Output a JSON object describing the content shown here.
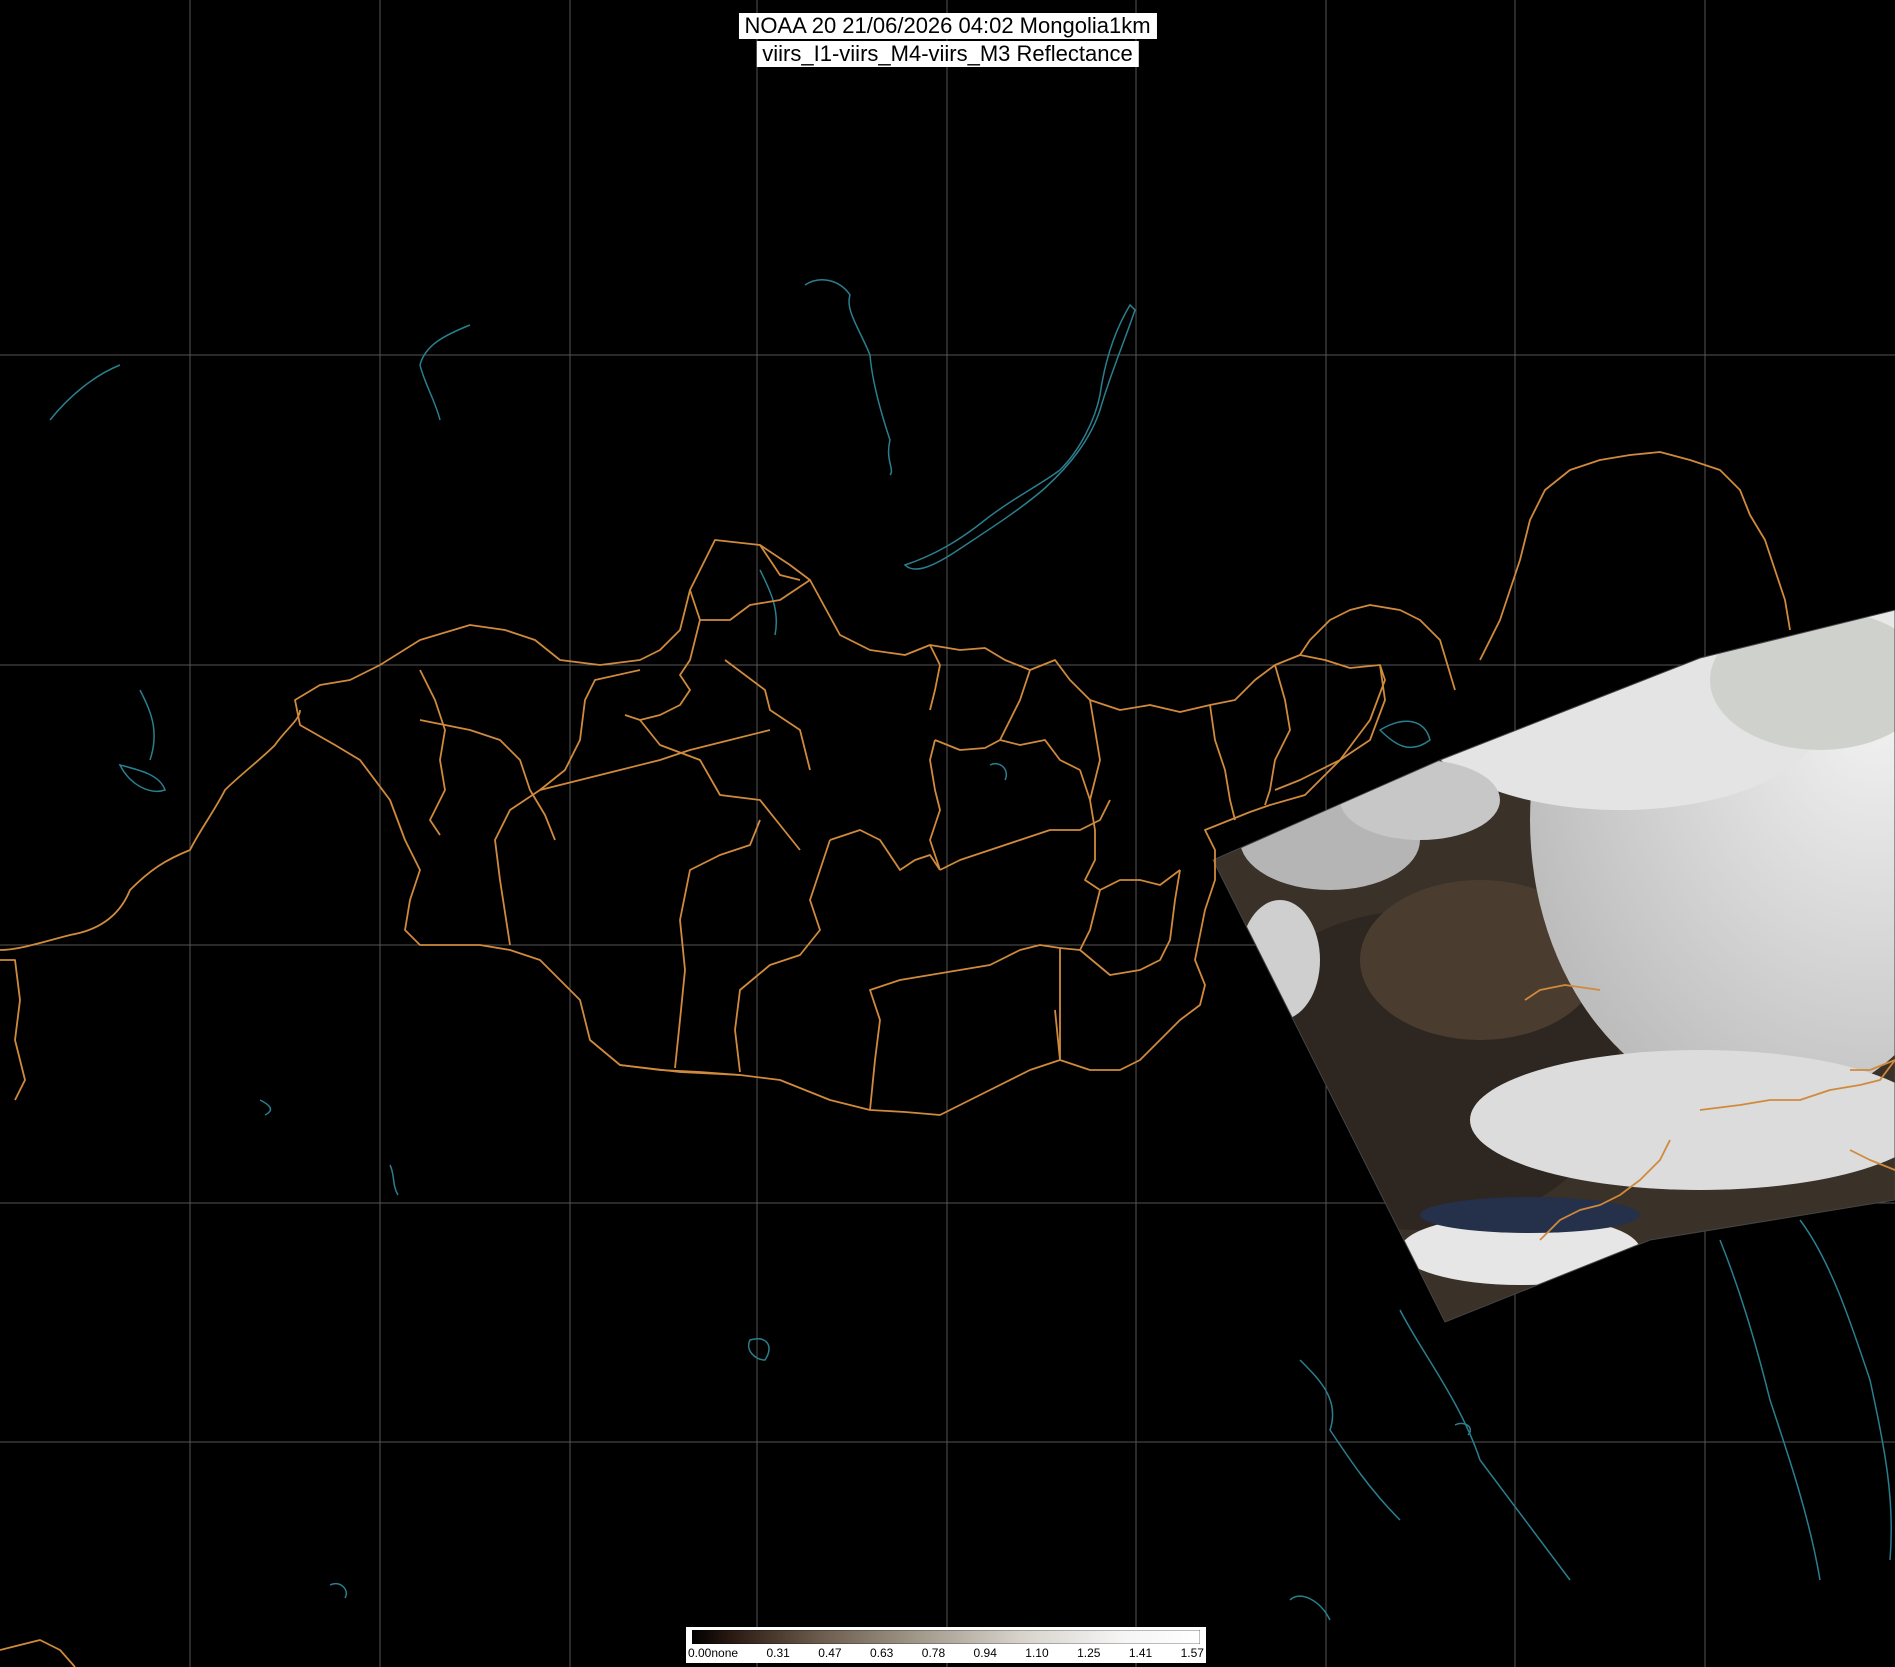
{
  "title": {
    "line1": "NOAA 20 21/06/2026 04:02 Mongolia1km",
    "line2": "viirs_I1-viirs_M4-viirs_M3 Reflectance"
  },
  "colors": {
    "background": "#000000",
    "graticule": "#555555",
    "border": "#d08a3c",
    "water": "#2a7f8f"
  },
  "colorbar": {
    "ticks": [
      "0.00none",
      "0.31",
      "0.47",
      "0.63",
      "0.78",
      "0.94",
      "1.10",
      "1.25",
      "1.41",
      "1.57"
    ]
  }
}
